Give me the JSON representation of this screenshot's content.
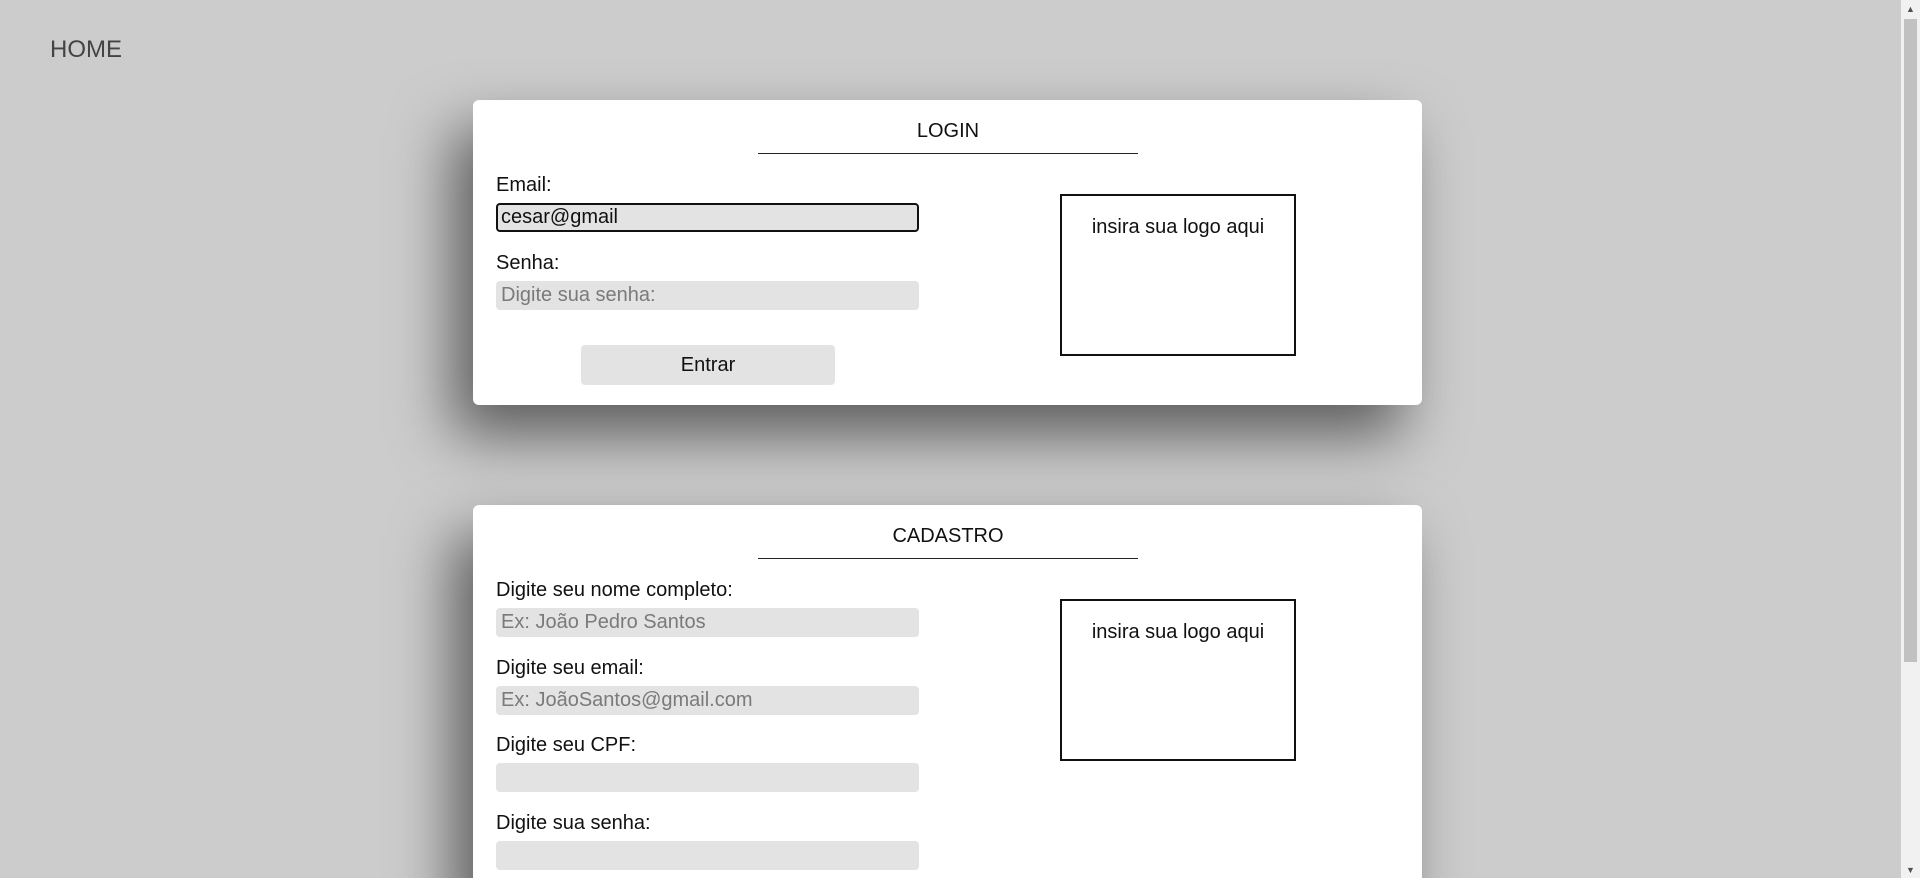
{
  "nav": {
    "home_label": "HOME"
  },
  "login": {
    "title": "LOGIN",
    "email_label": "Email:",
    "email_value": "cesar@gmail",
    "password_label": "Senha:",
    "password_placeholder": "Digite sua senha:",
    "submit_label": "Entrar",
    "logo_placeholder": "insira sua logo aqui"
  },
  "signup": {
    "title": "CADASTRO",
    "name_label": "Digite seu nome completo:",
    "name_placeholder": "Ex: João Pedro Santos",
    "email_label": "Digite seu email:",
    "email_placeholder": "Ex: JoãoSantos@gmail.com",
    "cpf_label": "Digite seu CPF:",
    "cpf_placeholder": "",
    "password_label": "Digite sua senha:",
    "password_placeholder": "",
    "logo_placeholder": "insira sua logo aqui"
  },
  "icons": {
    "scroll_up": "chevron-up-icon",
    "scroll_down": "chevron-down-icon"
  }
}
